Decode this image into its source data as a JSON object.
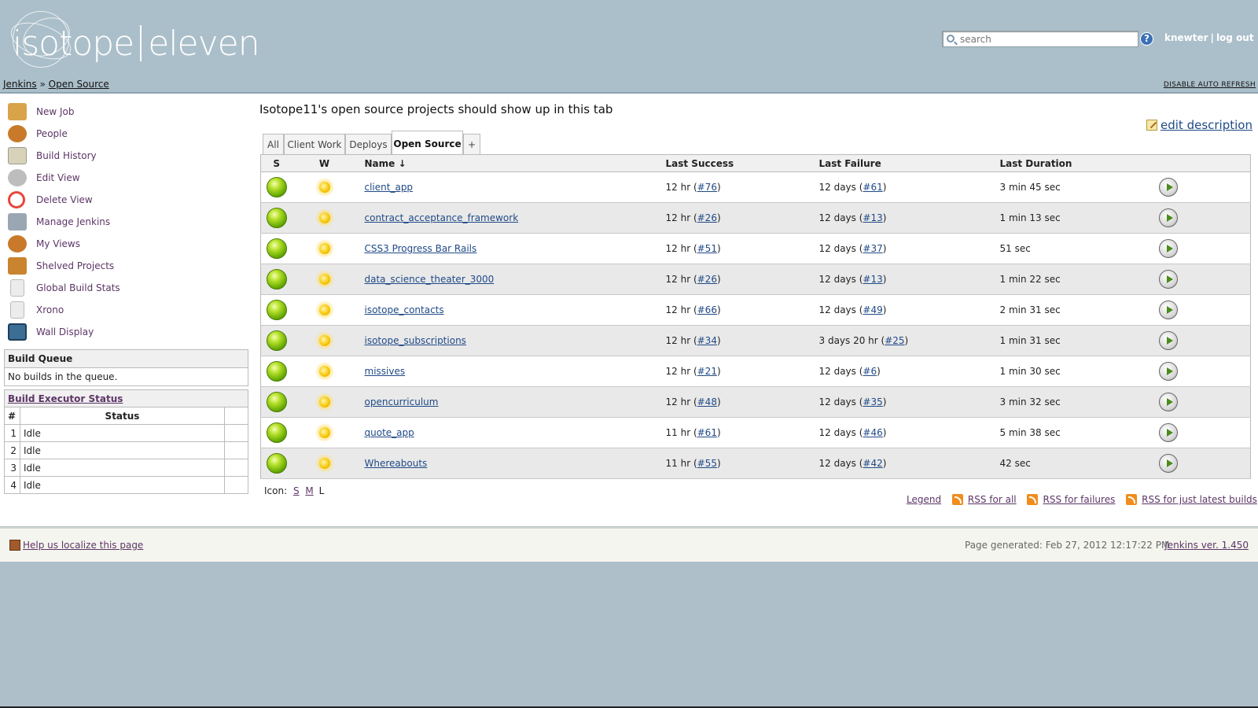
{
  "header": {
    "logo_text_left": "isotope",
    "logo_text_right": "eleven",
    "search_placeholder": "search",
    "username": "knewter",
    "separator": "|",
    "logout_label": "log out",
    "help_label": "?"
  },
  "breadcrumbs": {
    "root": "Jenkins",
    "separator": "»",
    "current": "Open Source"
  },
  "disable_refresh_label": "DISABLE AUTO REFRESH",
  "sidebar": {
    "tasks": [
      {
        "label": "New Job",
        "icon": "new-job-icon",
        "color": "#d9a34a"
      },
      {
        "label": "People",
        "icon": "people-icon",
        "color": "#c87a2a"
      },
      {
        "label": "Build History",
        "icon": "build-history-icon",
        "color": "#d8d2b8"
      },
      {
        "label": "Edit View",
        "icon": "gear-icon",
        "color": "#bdbdbd"
      },
      {
        "label": "Delete View",
        "icon": "no-entry-icon",
        "color": "#e8463b"
      },
      {
        "label": "Manage Jenkins",
        "icon": "tools-icon",
        "color": "#9aa7b3"
      },
      {
        "label": "My Views",
        "icon": "people-icon",
        "color": "#c87a2a"
      },
      {
        "label": "Shelved Projects",
        "icon": "drawer-icon",
        "color": "#c9842f"
      },
      {
        "label": "Global Build Stats",
        "icon": "document-icon",
        "color": "#e3e3e3"
      },
      {
        "label": "Xrono",
        "icon": "document-icon",
        "color": "#e3e3e3"
      },
      {
        "label": "Wall Display",
        "icon": "monitor-icon",
        "color": "#3c6e94"
      }
    ],
    "build_queue": {
      "title": "Build Queue",
      "empty_text": "No builds in the queue."
    },
    "executors": {
      "title": "Build Executor Status",
      "col_num": "#",
      "col_status": "Status",
      "rows": [
        {
          "num": "1",
          "status": "Idle"
        },
        {
          "num": "2",
          "status": "Idle"
        },
        {
          "num": "3",
          "status": "Idle"
        },
        {
          "num": "4",
          "status": "Idle"
        }
      ]
    }
  },
  "main": {
    "view_message": "Isotope11's open source projects should show up in this tab",
    "edit_description_label": "edit description",
    "tabs": [
      {
        "label": "All",
        "active": false
      },
      {
        "label": "Client Work",
        "active": false
      },
      {
        "label": "Deploys",
        "active": false
      },
      {
        "label": "Open Source",
        "active": true
      },
      {
        "label": "+",
        "active": false
      }
    ],
    "table": {
      "headers": {
        "status": "S",
        "weather": "W",
        "name": "Name",
        "sort_indicator": "↓",
        "last_success": "Last Success",
        "last_failure": "Last Failure",
        "last_duration": "Last Duration"
      },
      "rows": [
        {
          "name": "client_app",
          "success_time": "12 hr",
          "success_build": "#76",
          "failure_time": "12 days",
          "failure_build": "#61",
          "duration": "3 min 45 sec"
        },
        {
          "name": "contract_acceptance_framework",
          "success_time": "12 hr",
          "success_build": "#26",
          "failure_time": "12 days",
          "failure_build": "#13",
          "duration": "1 min 13 sec"
        },
        {
          "name": "CSS3 Progress Bar Rails",
          "success_time": "12 hr",
          "success_build": "#51",
          "failure_time": "12 days",
          "failure_build": "#37",
          "duration": "51 sec"
        },
        {
          "name": "data_science_theater_3000",
          "success_time": "12 hr",
          "success_build": "#26",
          "failure_time": "12 days",
          "failure_build": "#13",
          "duration": "1 min 22 sec"
        },
        {
          "name": "isotope_contacts",
          "success_time": "12 hr",
          "success_build": "#66",
          "failure_time": "12 days",
          "failure_build": "#49",
          "duration": "2 min 31 sec"
        },
        {
          "name": "isotope_subscriptions",
          "success_time": "12 hr",
          "success_build": "#34",
          "failure_time": "3 days 20 hr",
          "failure_build": "#25",
          "duration": "1 min 31 sec"
        },
        {
          "name": "missives",
          "success_time": "12 hr",
          "success_build": "#21",
          "failure_time": "12 days",
          "failure_build": "#6",
          "duration": "1 min 30 sec"
        },
        {
          "name": "opencurriculum",
          "success_time": "12 hr",
          "success_build": "#48",
          "failure_time": "12 days",
          "failure_build": "#35",
          "duration": "3 min 32 sec"
        },
        {
          "name": "quote_app",
          "success_time": "11 hr",
          "success_build": "#61",
          "failure_time": "12 days",
          "failure_build": "#46",
          "duration": "5 min 38 sec"
        },
        {
          "name": "Whereabouts",
          "success_time": "11 hr",
          "success_build": "#55",
          "failure_time": "12 days",
          "failure_build": "#42",
          "duration": "42 sec"
        }
      ]
    },
    "icon_size": {
      "label": "Icon:",
      "small": "S",
      "medium": "M",
      "large": "L"
    },
    "rss": {
      "legend": "Legend",
      "all": "RSS for all",
      "failures": "RSS for failures",
      "latest": "RSS for just latest builds"
    }
  },
  "footer": {
    "localize_label": "Help us localize this page",
    "generated_text": "Page generated: Feb 27, 2012 12:17:22 PM",
    "version_label": "Jenkins ver. 1.450"
  }
}
